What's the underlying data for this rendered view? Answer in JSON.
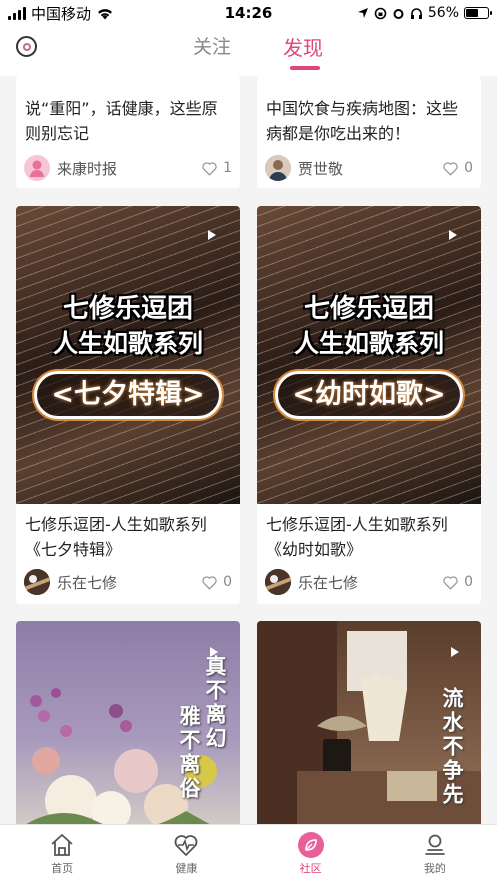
{
  "status_bar": {
    "carrier": "中国移动",
    "time": "14:26",
    "battery": "56%",
    "battery_level": 0.56
  },
  "header": {
    "tabs": [
      {
        "label": "关注",
        "active": false
      },
      {
        "label": "发现",
        "active": true
      }
    ],
    "accent_color": "#e0457b"
  },
  "feed": [
    {
      "title": "说“重阳”，话健康，这些原则别忘记",
      "author": "来康时报",
      "likes": "1"
    },
    {
      "title": "中国饮食与疾病地图：这些病都是你吃出来的！",
      "author": "贾世敬",
      "likes": "0"
    },
    {
      "title": "七修乐逗团-人生如歌系列《七夕特辑》",
      "author": "乐在七修",
      "likes": "0",
      "cover": {
        "line1": "七修乐逗团",
        "line2": "人生如歌系列",
        "badge": "<七夕特辑>"
      }
    },
    {
      "title": "七修乐逗团-人生如歌系列《幼时如歌》",
      "author": "乐在七修",
      "likes": "0",
      "cover": {
        "line1": "七修乐逗团",
        "line2": "人生如歌系列",
        "badge": "<幼时如歌>"
      }
    },
    {
      "cover_poem": [
        "真不离幻",
        "雅不离俗"
      ]
    },
    {
      "cover_poem": [
        "流水不争先"
      ]
    }
  ],
  "tabbar": {
    "items": [
      {
        "label": "首页",
        "icon": "home-icon",
        "active": false
      },
      {
        "label": "健康",
        "icon": "heart-pulse-icon",
        "active": false
      },
      {
        "label": "社区",
        "icon": "leaf-icon",
        "active": true
      },
      {
        "label": "我的",
        "icon": "user-icon",
        "active": false
      }
    ]
  }
}
